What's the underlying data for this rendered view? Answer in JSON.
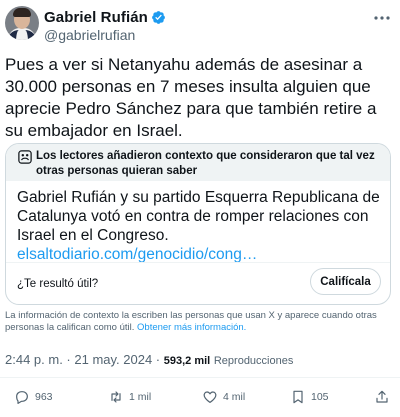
{
  "author": {
    "display_name": "Gabriel Rufián",
    "handle": "@gabrielrufian"
  },
  "tweet": {
    "text": "Pues a ver si Netanyahu además de asesinar a 30.000 personas en 7 meses insulta alguien que aprecie Pedro Sánchez para que también retire a su embajador en Israel."
  },
  "community_note": {
    "title": "Los lectores añadieron contexto que consideraron que tal vez otras personas quieran saber",
    "body": "Gabriel Rufián y su partido Esquerra Republicana de Catalunya votó en contra de romper relaciones con Israel en el Congreso.",
    "link": "elsaltodiario.com/genocidio/cong…",
    "question": "¿Te resultó útil?",
    "rate_label": "Califícala"
  },
  "context_info": {
    "text": "La información de contexto la escriben las personas que usan X y aparece cuando otras personas la califican como útil.",
    "link": "Obtener más información."
  },
  "meta": {
    "time": "2:44 p. m.",
    "separator": " · ",
    "date": "21 may. 2024",
    "views": "593,2 mil",
    "views_label": "Reproducciones"
  },
  "actions": {
    "replies": "963",
    "retweets": "1 mil",
    "likes": "4 mil",
    "bookmarks": "105"
  },
  "icons": {
    "verified": "verified-badge-icon",
    "more": "more-icon",
    "note": "community-note-icon",
    "reply": "reply-icon",
    "retweet": "retweet-icon",
    "like": "like-icon",
    "bookmark": "bookmark-icon",
    "share": "share-icon"
  },
  "colors": {
    "accent": "#1d9bf0",
    "text": "#0f1419",
    "secondary": "#536471",
    "border": "#cfd9de"
  }
}
